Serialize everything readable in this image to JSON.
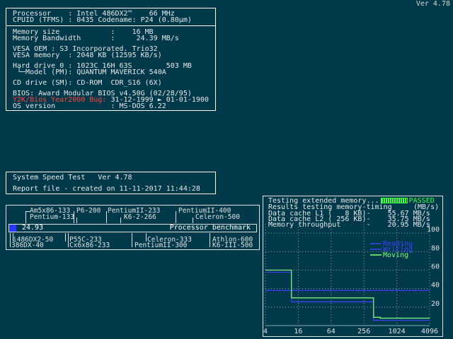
{
  "version": "Ver 4.78",
  "system_info": {
    "processor": "Processor    : Intel 486DX2™    66 MHz",
    "cpuid": "CPUID (TFMS) : 0435 Codename: P24 (0.80µm)",
    "memory_size": "Memory size            :    16 MB",
    "memory_bandwidth": "Memory Bandwidth       :     24.39 MB/s",
    "vesa_oem": "VESA OEM : S3 Incorporated. Trio32",
    "vesa_memory": "VESA memory  : 2048 KB (12595 KB/s)",
    "hard_drive": "Hard drive 0 : 1023C 16H 63S        503 MB",
    "hd_model": " └─Model (PM): QUANTUM MAVERICK 540A",
    "cd_drive": "CD drive (SM): CD-ROM  CDR_S16 (6X)",
    "bios": "BIOS: Award Modular BIOS v4.50G (02/28/95)",
    "y2k_label": "Y2K/Bios Year2000 Bug:",
    "y2k_value": " 31-12-1999 ► 01-01-1900",
    "os": "OS version             : MS-DOS 6.22"
  },
  "speed_test": {
    "title": "System Speed Test   Ver 4.78",
    "report": "Report file - created on 11-11-2017 11:44:28"
  },
  "benchmark": {
    "score": "24.93",
    "label": "Processor benchmark",
    "top_labels": {
      "am5x86": "Am5x86-133",
      "p6_200": "P6-200",
      "pentium2_233": "PentiumII-233",
      "pentium2_400": "PentiumII-400",
      "pentium_133": "Pentium-133",
      "k6_2_266": "K6-2-266",
      "celeron_500": "Celeron-500"
    },
    "bottom_labels": {
      "i486dx2_50": "i486DX2-50",
      "p55c_233": "P55C-233",
      "celeron_333": "Celeron-333",
      "athlon_600": "Athlon-600",
      "dx40": "386DX-40",
      "cx6x86_233": "Cx6x86-233",
      "pentium2_300": "PentiumII-300",
      "k6_3_500": "K6-III-500"
    },
    "score_fraction": 0.03
  },
  "memory_test": {
    "status_text": "Testing extended memory...",
    "status_result": "PASSED",
    "results_title": "Results testing memory-timing",
    "unit": "(MB/s)",
    "l1": "Data cache L1 (   8 KB)-    55.67 MB/s",
    "l2": "Data cache L2 ( 256 KB)-    35.75 MB/s",
    "throughput": "Memory throughput      -    20.95 MB/s",
    "legend": [
      "Reading",
      "Writing",
      "Moving"
    ],
    "colors": {
      "reading": "#4040ff",
      "writing": "#4040ff",
      "moving": "#80ff80",
      "passed": "#40ff40"
    }
  },
  "chart_data": {
    "type": "line",
    "x_ticks": [
      "4",
      "16",
      "64",
      "256",
      "1024",
      "4096"
    ],
    "y_ticks": [
      "20",
      "40",
      "60",
      "80",
      "100"
    ],
    "x": [
      4,
      8,
      12,
      16,
      32,
      64,
      128,
      256,
      384,
      512,
      1024,
      2048,
      4096
    ],
    "ylim": [
      0,
      110
    ],
    "x_scale": "log2",
    "grid": true,
    "series": [
      {
        "name": "Reading",
        "values": [
          38,
          38,
          38,
          38,
          38,
          38,
          38,
          38,
          38,
          38,
          38,
          38,
          38
        ]
      },
      {
        "name": "Writing",
        "values": [
          60,
          60,
          28,
          28,
          28,
          28,
          28,
          28,
          8,
          8,
          8,
          8,
          8
        ]
      },
      {
        "name": "Moving",
        "values": [
          60,
          60,
          30,
          30,
          30,
          30,
          30,
          30,
          9,
          8,
          8,
          8,
          8
        ]
      }
    ]
  }
}
